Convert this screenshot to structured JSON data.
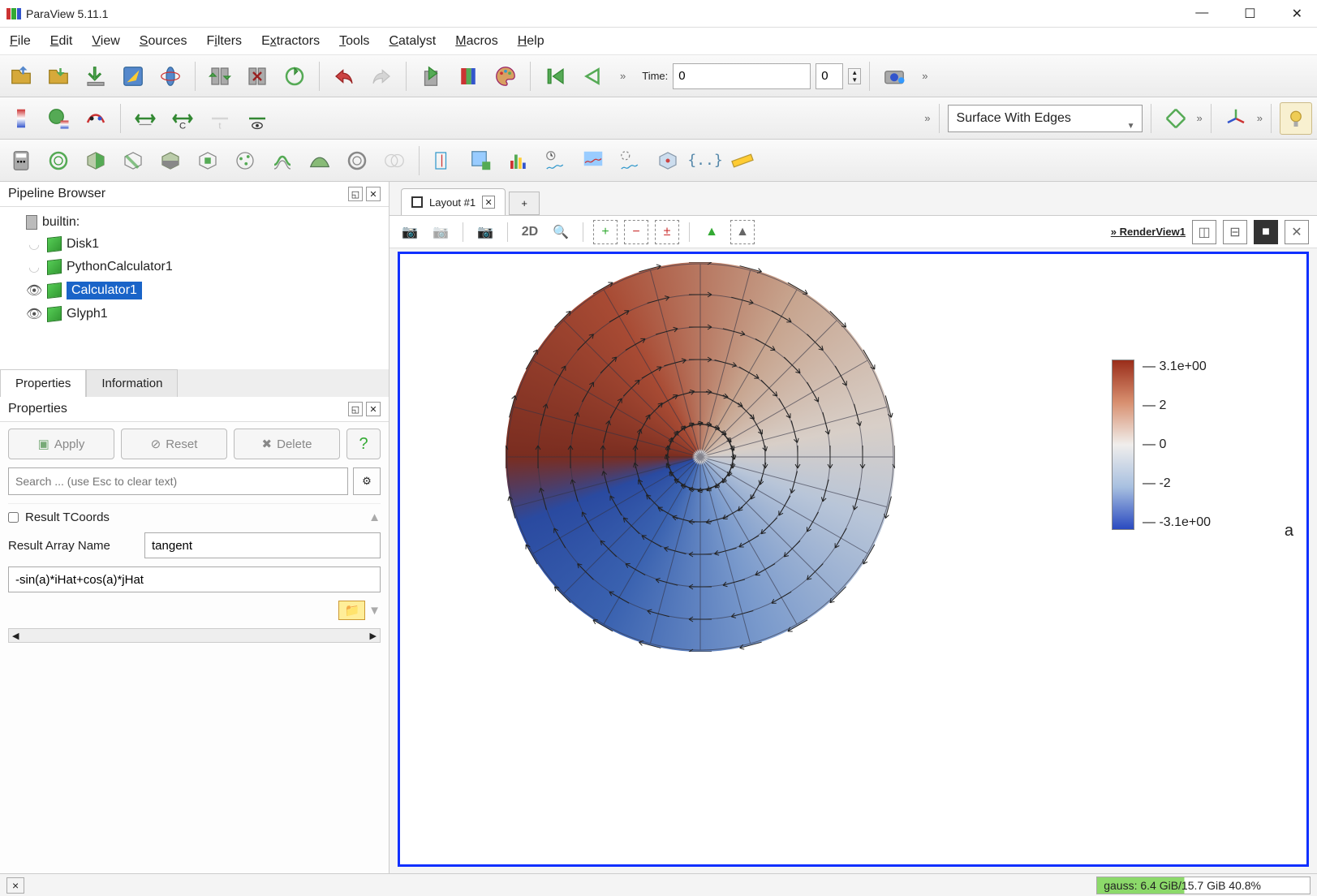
{
  "app": {
    "title": "ParaView 5.11.1"
  },
  "menu": [
    "File",
    "Edit",
    "View",
    "Sources",
    "Filters",
    "Extractors",
    "Tools",
    "Catalyst",
    "Macros",
    "Help"
  ],
  "time": {
    "label": "Time:",
    "value": "0",
    "index": "0"
  },
  "representation": "Surface With Edges",
  "pipeline": {
    "title": "Pipeline Browser",
    "server": "builtin:",
    "items": [
      {
        "name": "Disk1",
        "visible": false
      },
      {
        "name": "PythonCalculator1",
        "visible": false
      },
      {
        "name": "Calculator1",
        "visible": true,
        "selected": true
      },
      {
        "name": "Glyph1",
        "visible": true
      }
    ]
  },
  "properties": {
    "tab1": "Properties",
    "tab2": "Information",
    "header": "Properties",
    "apply": "Apply",
    "reset": "Reset",
    "delete": "Delete",
    "search_placeholder": "Search ... (use Esc to clear text)",
    "result_tcoords": "Result TCoords",
    "result_array_label": "Result Array Name",
    "result_array_value": "tangent",
    "expression": "-sin(a)*iHat+cos(a)*jHat"
  },
  "layout": {
    "name": "Layout #1",
    "render_view": "RenderView1",
    "twod": "2D"
  },
  "colorbar": {
    "ticks": [
      "3.1e+00",
      "2",
      "0",
      "-2",
      "-3.1e+00"
    ],
    "label": "a"
  },
  "status": {
    "close": "×",
    "memory": "gauss: 6.4 GiB/15.7 GiB 40.8%"
  },
  "chart_data": {
    "type": "heatmap",
    "title": "",
    "colormap": "Cool to Warm",
    "scalar_name": "a",
    "range": [
      -3.1,
      3.1
    ],
    "ticks": [
      -3.1,
      -2,
      0,
      2,
      3.1
    ],
    "geometry": "disk",
    "vector_field": "tangent = -sin(a)*iHat + cos(a)*jHat",
    "glyph_overlay": true
  }
}
